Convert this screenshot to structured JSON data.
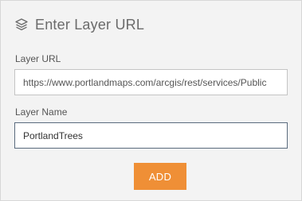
{
  "header": {
    "icon": "layers-icon",
    "title": "Enter Layer URL"
  },
  "form": {
    "layer_url": {
      "label": "Layer URL",
      "value": "https://www.portlandmaps.com/arcgis/rest/services/Public"
    },
    "layer_name": {
      "label": "Layer Name",
      "value": "PortlandTrees"
    },
    "add_button": {
      "label": "ADD",
      "color": "#ef8f36"
    }
  }
}
